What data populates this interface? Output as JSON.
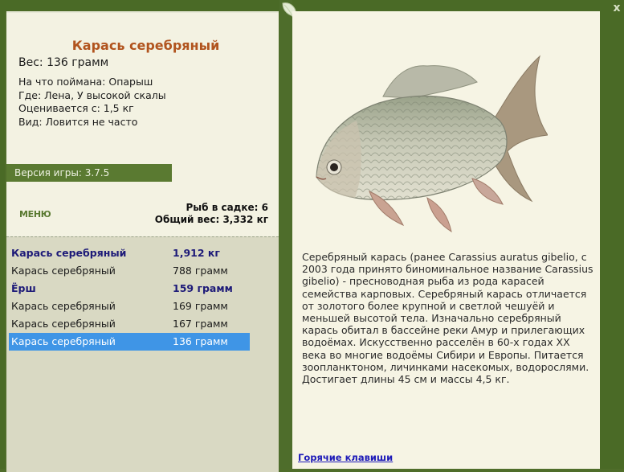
{
  "catch": {
    "title": "Карась серебряный",
    "weight": "Вес: 136 грамм",
    "caught_on": "На что поймана: Опарыш",
    "where": "Где: Лена, У высокой скалы",
    "valued_from": "Оценивается с: 1,5 кг",
    "kind": "Вид: Ловится не часто"
  },
  "version": "Версия игры: 3.7.5",
  "menu_label": "МЕНЮ",
  "stats": {
    "fish_count": "Рыб в садке: 6",
    "total_weight": "Общий вес: 3,332 кг"
  },
  "keepnet": [
    {
      "name": "Карась серебряный",
      "weight": "1,912 кг"
    },
    {
      "name": "Карась серебряный",
      "weight": "788 грамм"
    },
    {
      "name": "Ёрш",
      "weight": "159 грамм"
    },
    {
      "name": "Карась серебряный",
      "weight": "169 грамм"
    },
    {
      "name": "Карась серебряный",
      "weight": "167 грамм"
    },
    {
      "name": "Карась серебряный",
      "weight": "136 грамм"
    }
  ],
  "description": "Серебряный карась (ранее Carassius auratus gibelio, с 2003 года принято биноминальное название Carassius gibelio) - пресноводная рыба из рода карасей семейства карповых. Серебряный карась отличается от золотого более крупной и светлой чешуёй и меньшей высотой тела. Изначально серебряный карась обитал в бассейне реки Амур и прилегающих водоёмах. Искусственно расселён в 60-х годах XX века во многие водоёмы Сибири и Европы. Питается зоопланктоном, личинками насекомых, водорослями. Достигает длины 45 см и массы 4,5 кг.",
  "hotkeys_label": "Горячие клавиши",
  "close_label": "x",
  "icons": {
    "close": "close-icon",
    "leaf": "leaf-decoration-icon",
    "fish": "crucian-carp-image"
  }
}
